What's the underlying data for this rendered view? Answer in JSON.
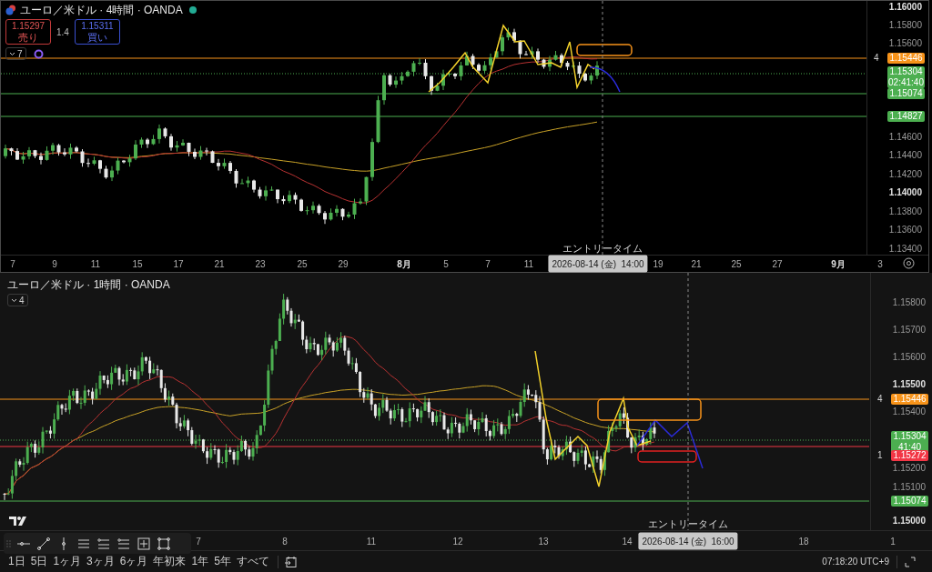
{
  "top_pane": {
    "title": "ユーロ／米ドル · 4時間 · OANDA",
    "market_open": true,
    "sell": {
      "price": "1.15297",
      "label": "売り"
    },
    "spread": "1.4",
    "buy": {
      "price": "1.15311",
      "label": "買い"
    },
    "indicator_count": "7",
    "price_ticks": [
      {
        "label": "1.16000",
        "kind": "major"
      },
      {
        "label": "1.15800",
        "kind": "minor"
      },
      {
        "label": "1.15600",
        "kind": "minor"
      },
      {
        "label": "1.14600",
        "kind": "minor"
      },
      {
        "label": "1.14400",
        "kind": "minor"
      },
      {
        "label": "1.14200",
        "kind": "minor"
      },
      {
        "label": "1.14000",
        "kind": "major"
      },
      {
        "label": "1.13800",
        "kind": "minor"
      },
      {
        "label": "1.13600",
        "kind": "minor"
      },
      {
        "label": "1.13400",
        "kind": "minor"
      }
    ],
    "price_tags": [
      {
        "price": "1.15446",
        "color": "#f7931a",
        "marker": "4"
      },
      {
        "price": "1.15304",
        "countdown": "02:41:40",
        "color": "#4caf50"
      },
      {
        "price": "1.15074",
        "color": "#4caf50"
      },
      {
        "price": "1.14827",
        "color": "#4caf50"
      }
    ],
    "time_ticks": [
      {
        "label": "7",
        "kind": "day"
      },
      {
        "label": "9",
        "kind": "day"
      },
      {
        "label": "11",
        "kind": "day"
      },
      {
        "label": "15",
        "kind": "day"
      },
      {
        "label": "17",
        "kind": "day"
      },
      {
        "label": "21",
        "kind": "day"
      },
      {
        "label": "23",
        "kind": "day"
      },
      {
        "label": "25",
        "kind": "day"
      },
      {
        "label": "29",
        "kind": "day"
      },
      {
        "label": "8月",
        "kind": "month"
      },
      {
        "label": "5",
        "kind": "day"
      },
      {
        "label": "7",
        "kind": "day"
      },
      {
        "label": "11",
        "kind": "day"
      },
      {
        "label": "19",
        "kind": "day"
      },
      {
        "label": "21",
        "kind": "day"
      },
      {
        "label": "25",
        "kind": "day"
      },
      {
        "label": "27",
        "kind": "day"
      },
      {
        "label": "9月",
        "kind": "month"
      },
      {
        "label": "3",
        "kind": "day"
      }
    ],
    "entry_label": "エントリータイム",
    "cursor_date": "2026-08-14 (金)  14:00"
  },
  "bottom_pane": {
    "title": "ユーロ／米ドル · 1時間 · OANDA",
    "indicator_count": "4",
    "price_ticks": [
      {
        "label": "1.15800",
        "kind": "minor"
      },
      {
        "label": "1.15700",
        "kind": "minor"
      },
      {
        "label": "1.15600",
        "kind": "minor"
      },
      {
        "label": "1.15500",
        "kind": "major"
      },
      {
        "label": "1.15400",
        "kind": "minor"
      },
      {
        "label": "1.15200",
        "kind": "minor"
      },
      {
        "label": "1.15100",
        "kind": "minor"
      },
      {
        "label": "1.15000",
        "kind": "major"
      }
    ],
    "price_tags": [
      {
        "price": "1.15446",
        "color": "#f7931a",
        "marker": "4"
      },
      {
        "price": "1.15304",
        "countdown": "41:40",
        "color": "#4caf50"
      },
      {
        "price": "1.15272",
        "color": "#f23645",
        "marker": "1"
      },
      {
        "price": "1.15074",
        "color": "#4caf50"
      }
    ],
    "time_ticks": [
      {
        "label": "7"
      },
      {
        "label": "8"
      },
      {
        "label": "11"
      },
      {
        "label": "12"
      },
      {
        "label": "13"
      },
      {
        "label": "14"
      },
      {
        "label": "18"
      },
      {
        "label": "1"
      }
    ],
    "entry_label": "エントリータイム",
    "cursor_date": "2026-08-14 (金)  16:00"
  },
  "range_buttons": [
    "1日",
    "5日",
    "1ヶ月",
    "3ヶ月",
    "6ヶ月",
    "年初来",
    "1年",
    "5年",
    "すべて"
  ],
  "clock": "07:18:20 UTC+9"
}
